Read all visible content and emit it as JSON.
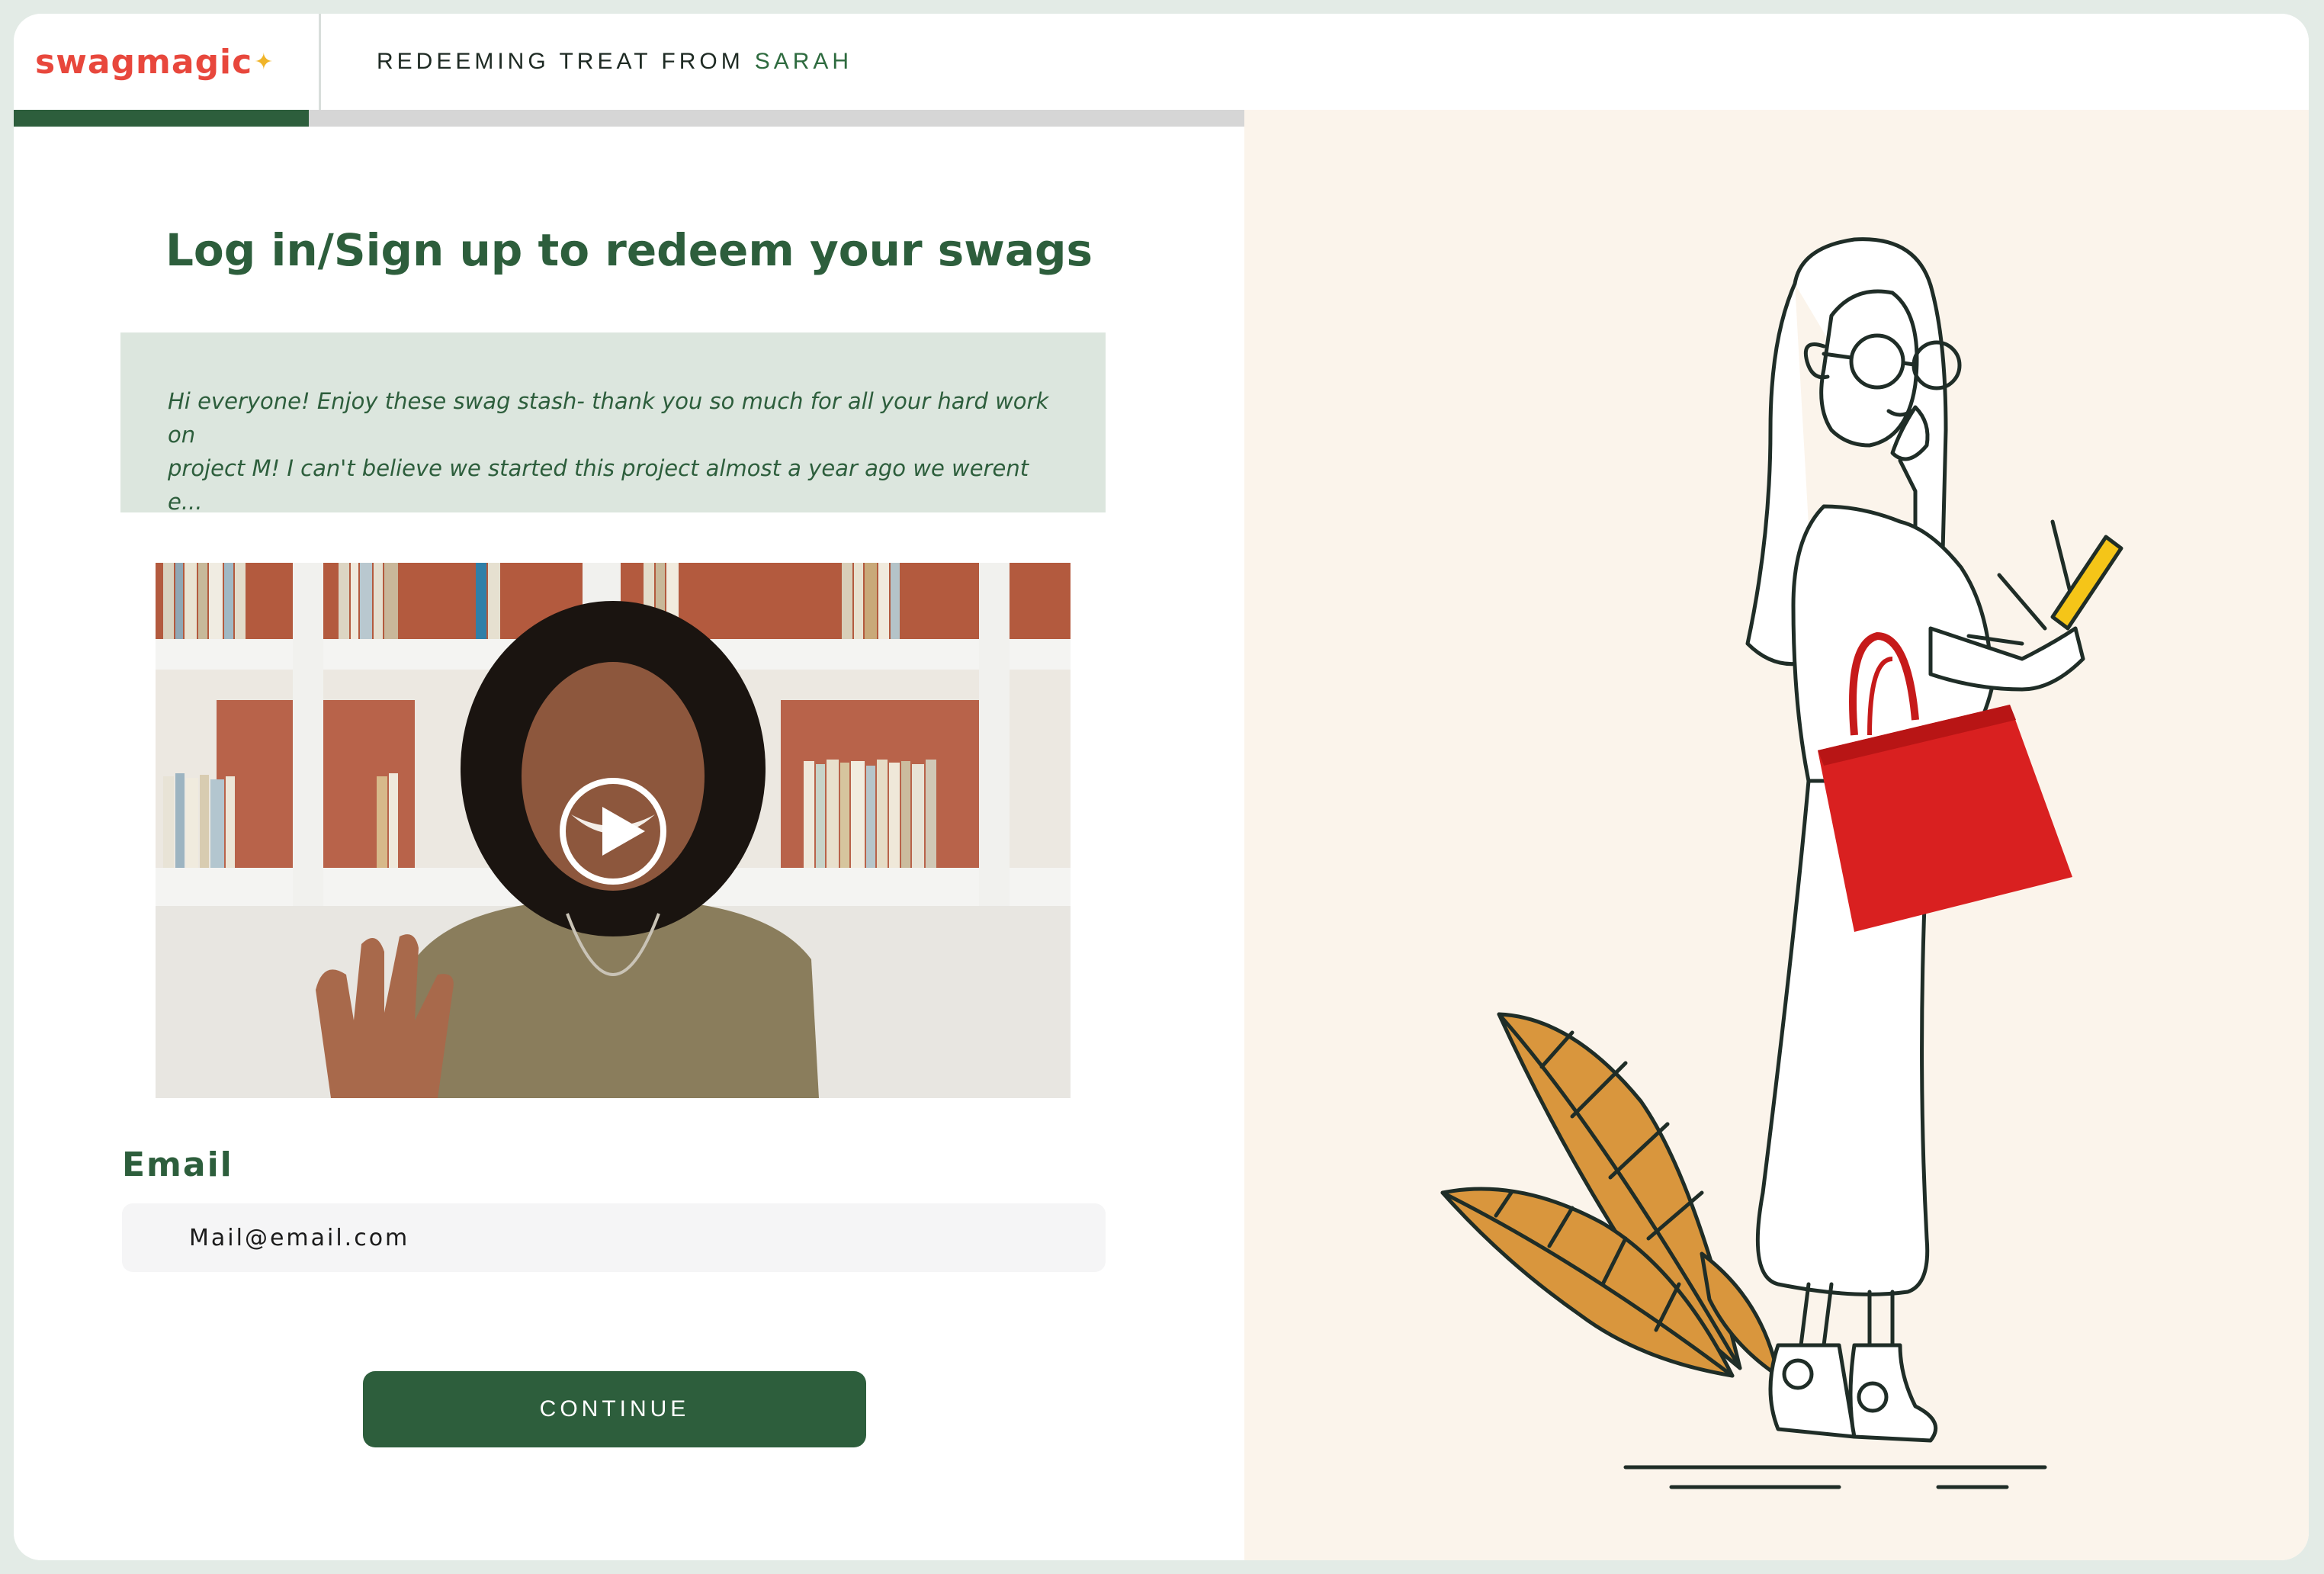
{
  "brand": {
    "logo_text": "swagmagic",
    "logo_sparkle": "✦",
    "color": "#e8473c"
  },
  "header": {
    "redeem_prefix": "REDEEMING TREAT FROM",
    "sender_name": "SARAH"
  },
  "progress": {
    "fraction": 0.24
  },
  "main": {
    "title": "Log in/Sign up to redeem your swags",
    "message_line_1": "Hi everyone! Enjoy these swag stash- thank you so much for all your hard work on",
    "message_line_2": "project M! I can't believe we started this project almost a year ago we werent e..."
  },
  "video": {
    "play_icon": "play-icon"
  },
  "form": {
    "email_label": "Email",
    "email_value": "Mail@email.com",
    "continue_label": "CONTINUE"
  },
  "colors": {
    "primary_green": "#2d5e3c",
    "message_bg": "#dce6de",
    "right_bg": "#fbf4eb",
    "bag_red": "#d92020",
    "leaf_orange": "#d9963d",
    "phone_yellow": "#f5c518"
  }
}
